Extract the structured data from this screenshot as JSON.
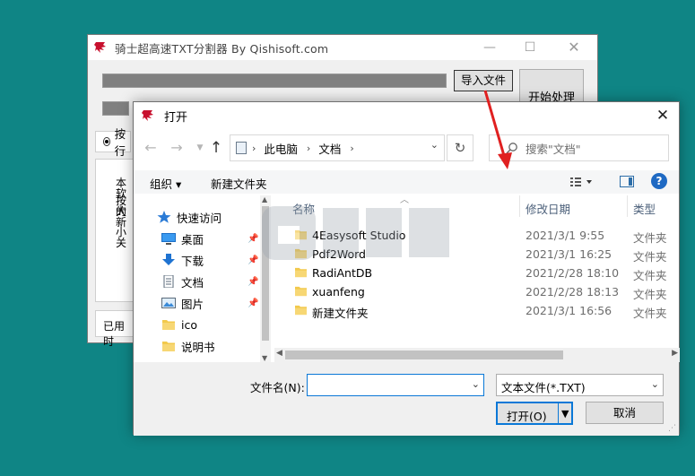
{
  "background_color": "#0f8585",
  "back_window": {
    "title": "骑士超高速TXT分割器  By Qishisoft.com",
    "import_button": "导入文件",
    "start_button": "开始处理",
    "radio_label": "按行",
    "text_lines": [
      "本软",
      "按大",
      "的新",
      "小关"
    ],
    "used_time_label": "已用时"
  },
  "dialog": {
    "title": "打开",
    "breadcrumb": [
      "此电脑",
      "文档"
    ],
    "search_placeholder": "搜索\"文档\"",
    "toolbar": {
      "organize": "组织",
      "new_folder": "新建文件夹",
      "help": "?"
    },
    "nav_items": [
      {
        "label": "快速访问",
        "icon": "star-icon"
      },
      {
        "label": "桌面",
        "icon": "desktop-icon"
      },
      {
        "label": "下载",
        "icon": "download-icon"
      },
      {
        "label": "文档",
        "icon": "document-icon"
      },
      {
        "label": "图片",
        "icon": "picture-icon"
      },
      {
        "label": "ico",
        "icon": "folder-icon"
      },
      {
        "label": "说明书",
        "icon": "folder-icon"
      }
    ],
    "columns": {
      "name": "名称",
      "date": "修改日期",
      "type": "类型"
    },
    "files": [
      {
        "name": "4Easysoft Studio",
        "date": "2021/3/1 9:55",
        "type": "文件夹"
      },
      {
        "name": "Pdf2Word",
        "date": "2021/3/1 16:25",
        "type": "文件夹"
      },
      {
        "name": "RadiAntDB",
        "date": "2021/2/28 18:10",
        "type": "文件夹"
      },
      {
        "name": "xuanfeng",
        "date": "2021/2/28 18:13",
        "type": "文件夹"
      },
      {
        "name": "新建文件夹",
        "date": "2021/3/1 16:56",
        "type": "文件夹"
      }
    ],
    "filename_label": "文件名(N):",
    "filename_value": "",
    "filetype_value": "文本文件(*.TXT)",
    "open_button": "打开(O)",
    "cancel_button": "取消"
  },
  "annotation_arrow_color": "#e02020",
  "accent_color": "#0a78d7"
}
